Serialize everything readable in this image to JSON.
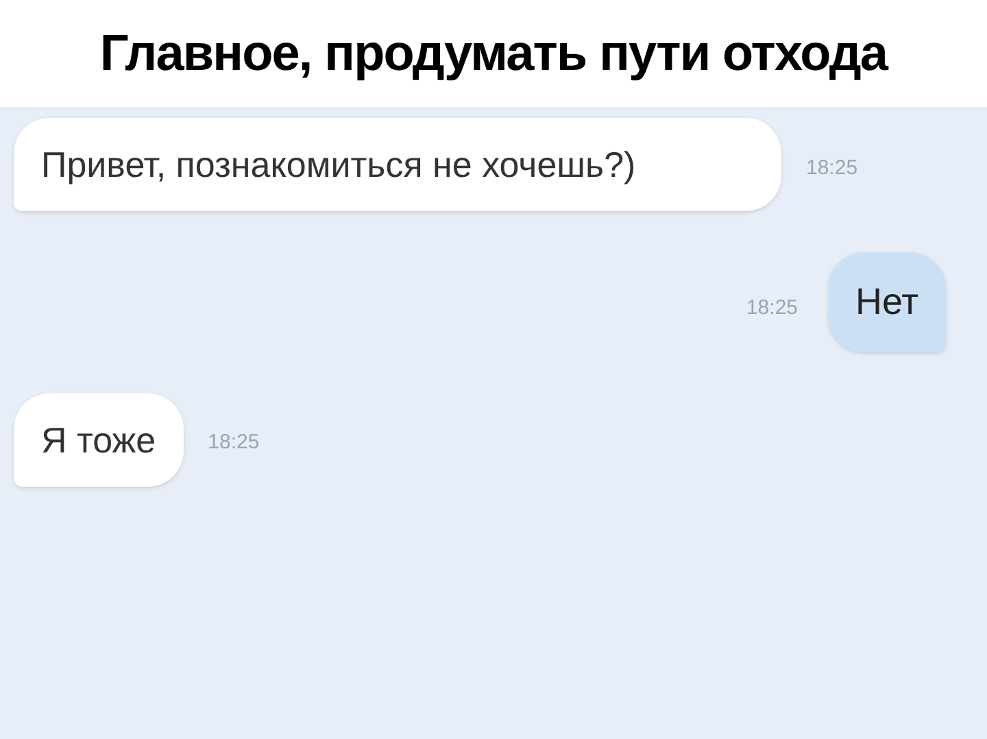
{
  "caption": "Главное, продумать пути отхода",
  "messages": [
    {
      "kind": "incoming",
      "text": "Привет, познакомиться не хочешь?)",
      "time": "18:25"
    },
    {
      "kind": "outgoing",
      "text": "Нет",
      "time": "18:25"
    },
    {
      "kind": "incoming",
      "text": "Я тоже",
      "time": "18:25"
    }
  ]
}
